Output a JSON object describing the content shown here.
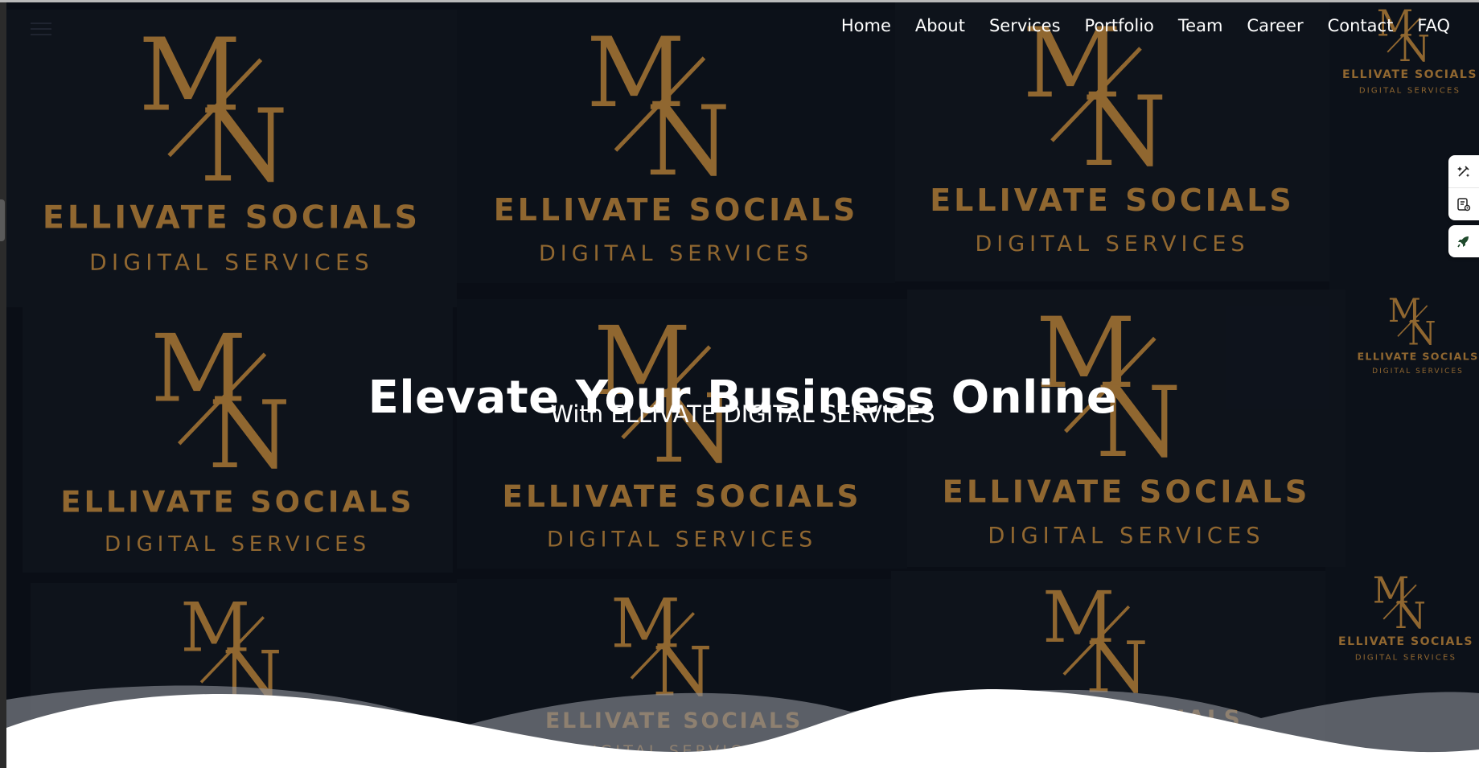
{
  "nav": {
    "items": [
      "Home",
      "About",
      "Services",
      "Portfolio",
      "Team",
      "Career",
      "Contact",
      "FAQ"
    ]
  },
  "hero": {
    "title": "Elevate Your Business Online",
    "subtitle": "With ELLIVATE DIGITAL SERVICES"
  },
  "logo": {
    "monogram_top": "M",
    "monogram_bottom": "N",
    "brand": "ELLIVATE SOCIALS",
    "tagline": "DIGITAL SERVICES"
  },
  "colors": {
    "gold": "#c4893a",
    "background": "#0c1017",
    "wave_grey": "#8c9098",
    "wave_white": "#ffffff",
    "tool_green": "#1f4a2c"
  },
  "icons": {
    "tool_1": "edit-sparkle-icon",
    "tool_2": "document-settings-icon",
    "tool_3": "rocket-icon"
  }
}
